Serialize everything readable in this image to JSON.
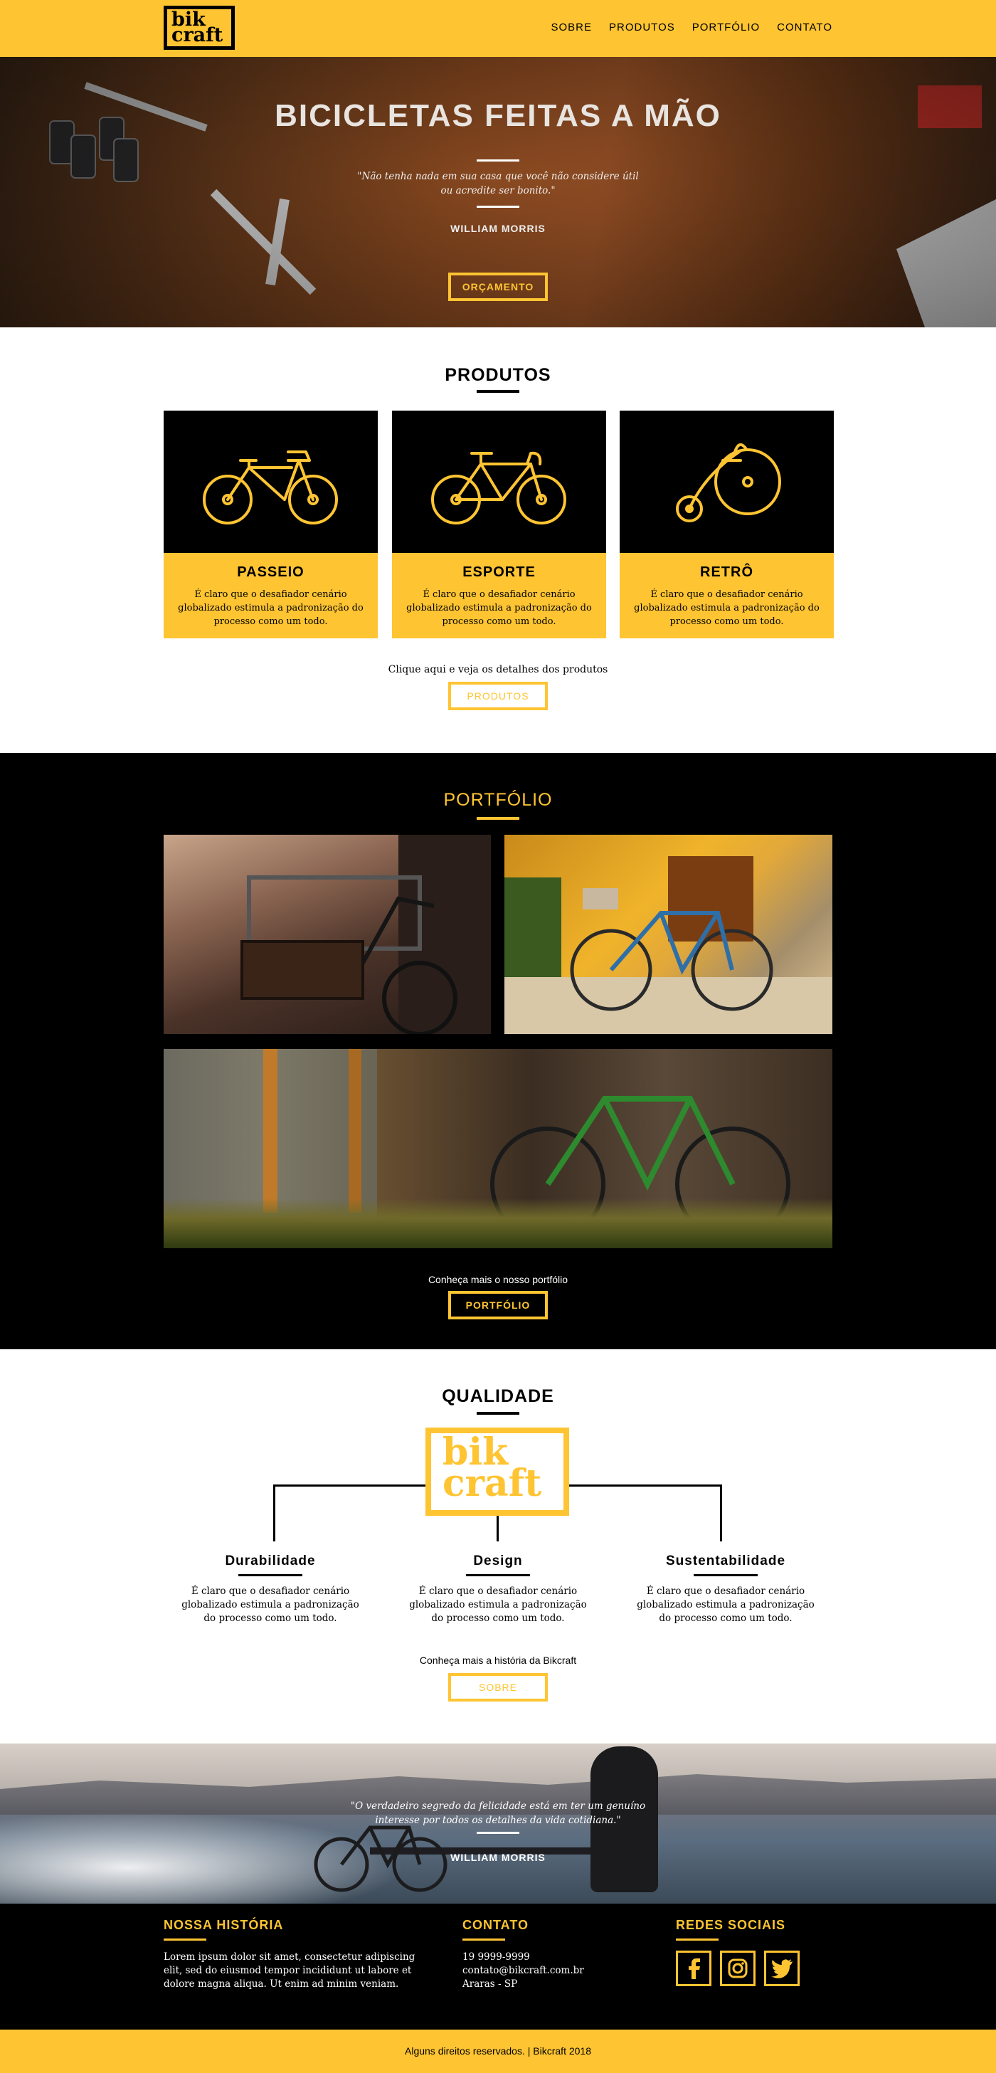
{
  "brand": {
    "logo_line1": "bik",
    "logo_line2": "craft",
    "accent": "#FEC432"
  },
  "nav": [
    "SOBRE",
    "PRODUTOS",
    "PORTFÓLIO",
    "CONTATO"
  ],
  "hero": {
    "title": "BICICLETAS FEITAS A MÃO",
    "quote": "\"Não tenha nada em sua casa que você não considere útil ou acredite ser bonito.\"",
    "author": "WILLIAM MORRIS",
    "button": "ORÇAMENTO"
  },
  "produtos": {
    "title": "PRODUTOS",
    "items": [
      {
        "name": "PASSEIO",
        "icon": "city-bike-icon",
        "text": "É claro que o desafiador cenário globalizado estimula a padronização do processo como um todo."
      },
      {
        "name": "ESPORTE",
        "icon": "sport-bike-icon",
        "text": "É claro que o desafiador cenário globalizado estimula a padronização do processo como um todo."
      },
      {
        "name": "RETRÔ",
        "icon": "penny-farthing-icon",
        "text": "É claro que o desafiador cenário globalizado estimula a padronização do processo como um todo."
      }
    ],
    "cta": "Clique aqui e veja os detalhes dos produtos",
    "button": "PRODUTOS"
  },
  "portfolio": {
    "title": "PORTFÓLIO",
    "cta": "Conheça mais o nosso portfólio",
    "button": "PORTFÓLIO"
  },
  "qualidade": {
    "title": "QUALIDADE",
    "items": [
      {
        "name": "Durabilidade",
        "text": "É claro que o desafiador cenário globalizado estimula a padronização do processo como um todo."
      },
      {
        "name": "Design",
        "text": "É claro que o desafiador cenário globalizado estimula a padronização do processo como um todo."
      },
      {
        "name": "Sustentabilidade",
        "text": "É claro que o desafiador cenário globalizado estimula a padronização do processo como um todo."
      }
    ],
    "cta": "Conheça mais a história da Bikcraft",
    "button": "SOBRE"
  },
  "quote2": {
    "text": "\"O verdadeiro segredo da felicidade está em ter um genuíno interesse por todos os detalhes da vida cotidiana.\"",
    "author": "WILLIAM MORRIS"
  },
  "footer": {
    "historia_title": "NOSSA HISTÓRIA",
    "historia_text": "Lorem ipsum dolor sit amet, consectetur adipiscing elit, sed do eiusmod tempor incididunt ut labore et dolore magna aliqua. Ut enim ad minim veniam.",
    "contato_title": "CONTATO",
    "phone": "19 9999-9999",
    "email": "contato@bikcraft.com.br",
    "city": "Araras - SP",
    "social_title": "REDES SOCIAIS",
    "social": [
      "facebook-icon",
      "instagram-icon",
      "twitter-icon"
    ],
    "copyright": "Alguns direitos reservados. | Bikcraft 2018"
  }
}
